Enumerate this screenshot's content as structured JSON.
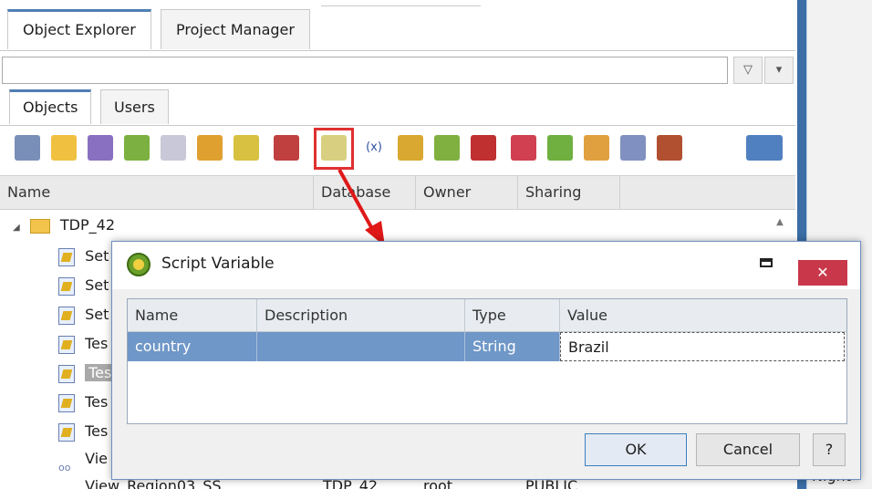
{
  "top_tabs": {
    "object_explorer": "Object Explorer",
    "project_manager": "Project Manager"
  },
  "filter": {
    "value": "",
    "filter_glyph": "▽",
    "dropdown_glyph": "▾"
  },
  "sub_tabs": {
    "objects": "Objects",
    "users": "Users"
  },
  "toolbar": {
    "icons": [
      "users-delete-icon",
      "new-folder-icon",
      "copy-object-icon",
      "edit-object-icon",
      "move-object-icon",
      "forward-object-icon",
      "tag-object-icon",
      "delete-object-icon",
      "script-variables-icon",
      "variable-icon",
      "report-icon",
      "refresh-icon",
      "remove-icon",
      "lock-icon",
      "unlock-icon",
      "edit-icon",
      "export-icon",
      "script-icon",
      "grid-menu-icon"
    ]
  },
  "columns": {
    "name": "Name",
    "database": "Database",
    "owner": "Owner",
    "sharing": "Sharing"
  },
  "tree": {
    "root": {
      "expander": "◢",
      "label": "TDP_42"
    },
    "items": [
      "Set",
      "Set",
      "Set",
      "Tes",
      "Tes",
      "Tes",
      "Tes",
      "Vie"
    ],
    "bottom_row": {
      "name": "View_Region03_SS",
      "database": "TDP_42",
      "owner": "root",
      "sharing": "PUBLIC"
    }
  },
  "right_text": "Night-",
  "dialog": {
    "title": "Script Variable",
    "minimize": "",
    "close": "✕",
    "grid": {
      "headers": {
        "name": "Name",
        "description": "Description",
        "type": "Type",
        "value": "Value"
      },
      "rows": [
        {
          "name": "country",
          "description": "",
          "type": "String",
          "value": "Brazil"
        }
      ]
    },
    "ok_label": "OK",
    "cancel_label": "Cancel",
    "help_label": "?"
  },
  "colors": {
    "highlight": "#e03030",
    "selection": "#6f97c7",
    "close_btn": "#c8384a"
  }
}
